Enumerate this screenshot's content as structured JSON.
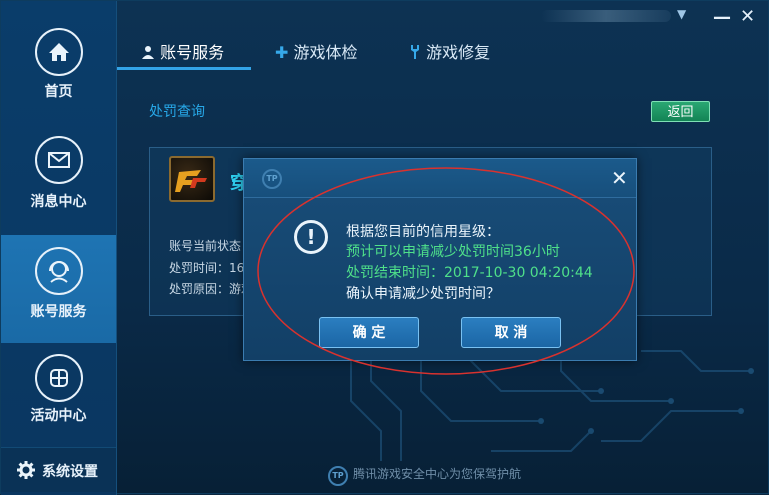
{
  "sidebar": {
    "items": [
      {
        "label": "首页",
        "icon": "home-icon"
      },
      {
        "label": "消息中心",
        "icon": "mail-icon"
      },
      {
        "label": "账号服务",
        "icon": "headset-icon"
      },
      {
        "label": "活动中心",
        "icon": "grid-icon"
      }
    ],
    "settings_label": "系统设置"
  },
  "tabs": [
    {
      "label": "账号服务",
      "icon": "user-icon",
      "active": true
    },
    {
      "label": "游戏体检",
      "icon": "plus-icon",
      "active": false
    },
    {
      "label": "游戏修复",
      "icon": "wrench-icon",
      "active": false
    }
  ],
  "main": {
    "section_title": "处罚查询",
    "back_label": "返回",
    "game_title": "穿",
    "info": {
      "status_label": "账号当前状态",
      "time_label": "处罚时间：16",
      "reason_label": "处罚原因：游戏"
    }
  },
  "dialog": {
    "line1": "根据您目前的信用星级：",
    "line2": "预计可以申请减少处罚时间36小时",
    "line3": "处罚结束时间：2017-10-30 04:20:44",
    "line4": "确认申请减少处罚时间？",
    "confirm_label": "确 定",
    "cancel_label": "取 消"
  },
  "footer": {
    "text": "腾讯游戏安全中心为您保驾护航"
  },
  "colors": {
    "accent": "#27a8e8",
    "highlight_green": "#4fe08a",
    "back_button": "#1f9a66",
    "annotation_red": "#d9322e"
  }
}
